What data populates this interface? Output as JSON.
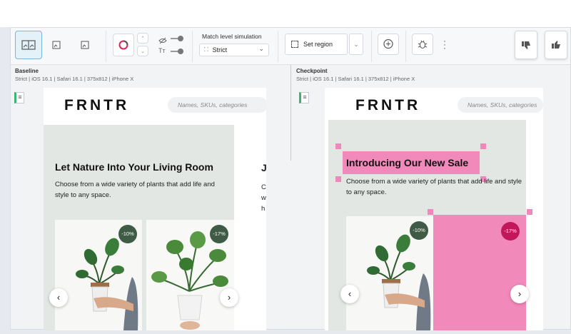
{
  "toolbar": {
    "match_label": "Match level simulation",
    "match_value": "Strict",
    "region_label": "Set region"
  },
  "baseline": {
    "title": "Baseline",
    "meta": "Strict | iOS 16.1 | Safari 16.1 | 375x812 | iPhone X"
  },
  "checkpoint": {
    "title": "Checkpoint",
    "meta": "Strict | iOS 16.1 | Safari 16.1 | 375x812 | iPhone X"
  },
  "site": {
    "logo": "FRNTR",
    "search_placeholder": "Names, SKUs, categories",
    "baseline_hero_title": "Let Nature Into Your Living Room",
    "checkpoint_hero_title": "Introducing Our New Sale",
    "hero_desc": "Choose from a wide variety of plants that add life and style to any space.",
    "next_slide_letter": "J",
    "next_slide_lines": [
      "C",
      "w",
      "h"
    ],
    "badge_left": "-10%",
    "badge_right": "-17%",
    "prev_arrow": "‹",
    "next_arrow": "›"
  },
  "colors": {
    "diff_highlight": "#f478b4",
    "accent_blue": "#78b7d6",
    "badge_green": "#3f5a45",
    "diff_badge": "#c2185b"
  }
}
